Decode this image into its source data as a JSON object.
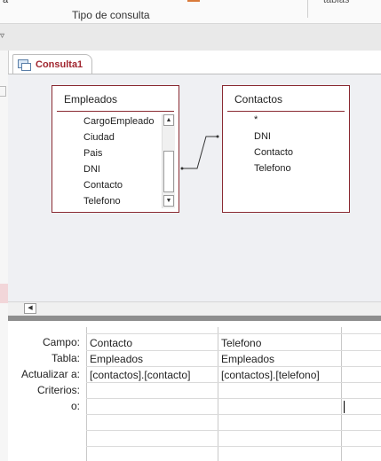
{
  "ribbon": {
    "group_label": "Tipo de consulta",
    "top_right_fragment": "tablas"
  },
  "document": {
    "tab_label": "Consulta1"
  },
  "tables": [
    {
      "name": "Empleados",
      "fields": [
        "CargoEmpleado",
        "Ciudad",
        "Pais",
        "DNI",
        "Contacto",
        "Telefono"
      ]
    },
    {
      "name": "Contactos",
      "fields": [
        "*",
        "DNI",
        "Contacto",
        "Telefono"
      ]
    }
  ],
  "grid": {
    "row_labels": [
      "Campo:",
      "Tabla:",
      "Actualizar a:",
      "Criterios:",
      "o:"
    ],
    "columns": [
      {
        "campo": "Contacto",
        "tabla": "Empleados",
        "actualizar": "[contactos].[contacto]"
      },
      {
        "campo": "Telefono",
        "tabla": "Empleados",
        "actualizar": "[contactos].[telefono]"
      }
    ]
  },
  "colors": {
    "accent": "#a0252e",
    "table_border": "#8a2a32",
    "design_bg": "#eff0f3"
  }
}
